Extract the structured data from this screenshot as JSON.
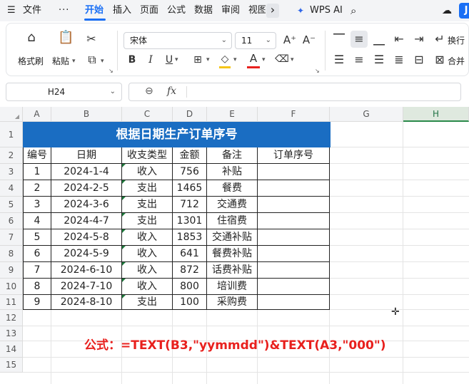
{
  "menubar": {
    "file_label": "文件",
    "more_label": "···",
    "tabs": [
      "开始",
      "插入",
      "页面",
      "公式",
      "数据",
      "审阅",
      "视图"
    ],
    "next_label": "›",
    "wps_ai_label": "WPS AI",
    "avatar_letter": "J"
  },
  "ribbon": {
    "format_painter_label": "格式刷",
    "paste_label": "粘贴",
    "font_name": "宋体",
    "font_size": "11",
    "bold_label": "B",
    "italic_label": "I",
    "underline_label": "U",
    "font_color_letter": "A",
    "wrap_label": "换行",
    "merge_label": "合并",
    "accent_color": "#1a6ff5",
    "font_color_bar": "#e8201d",
    "fill_color_bar": "#f5c518"
  },
  "formula_bar": {
    "cell_ref": "H24",
    "fx_label": "fx",
    "value": ""
  },
  "columns": [
    "A",
    "B",
    "C",
    "D",
    "E",
    "F",
    "G",
    "H"
  ],
  "selected_column": "H",
  "rows": [
    "1",
    "2",
    "3",
    "4",
    "5",
    "6",
    "7",
    "8",
    "9",
    "10",
    "11",
    "12",
    "13",
    "14",
    "15"
  ],
  "sheet": {
    "title": "根据日期生产订单序号",
    "title_bg": "#1a6dc2",
    "headers": [
      "编号",
      "日期",
      "收支类型",
      "金额",
      "备注",
      "订单序号"
    ],
    "records": [
      [
        "1",
        "2024-1-4",
        "收入",
        "756",
        "补贴",
        ""
      ],
      [
        "2",
        "2024-2-5",
        "支出",
        "1465",
        "餐费",
        ""
      ],
      [
        "3",
        "2024-3-6",
        "支出",
        "712",
        "交通费",
        ""
      ],
      [
        "4",
        "2024-4-7",
        "支出",
        "1301",
        "住宿费",
        ""
      ],
      [
        "5",
        "2024-5-8",
        "收入",
        "1853",
        "交通补贴",
        ""
      ],
      [
        "6",
        "2024-5-9",
        "收入",
        "641",
        "餐费补贴",
        ""
      ],
      [
        "7",
        "2024-6-10",
        "收入",
        "872",
        "话费补贴",
        ""
      ],
      [
        "8",
        "2024-7-10",
        "收入",
        "800",
        "培训费",
        ""
      ],
      [
        "9",
        "2024-8-10",
        "支出",
        "100",
        "采购费",
        ""
      ]
    ]
  },
  "formula_note": "公式：=TEXT(B3,\"yymmdd\")&TEXT(A3,\"000\")",
  "note_color": "#e8201d"
}
